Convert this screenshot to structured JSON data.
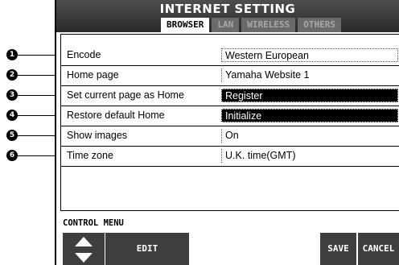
{
  "window": {
    "title": "INTERNET SETTING"
  },
  "tabs": [
    {
      "label": "BROWSER",
      "active": true
    },
    {
      "label": "LAN",
      "active": false
    },
    {
      "label": "WIRELESS",
      "active": false
    },
    {
      "label": "OTHERS",
      "active": false
    }
  ],
  "settings": [
    {
      "number": "1",
      "label": "Encode",
      "value": "Western European"
    },
    {
      "number": "2",
      "label": "Home page",
      "value": "Yamaha Website 1"
    },
    {
      "number": "3",
      "label": "Set current page as Home",
      "value": "Register"
    },
    {
      "number": "4",
      "label": "Restore default Home",
      "value": "Initialize"
    },
    {
      "number": "5",
      "label": "Show images",
      "value": "On"
    },
    {
      "number": "6",
      "label": "Time zone",
      "value": "U.K. time(GMT)"
    }
  ],
  "control_menu": {
    "label": "CONTROL MENU",
    "edit_label": "EDIT",
    "save_label": "SAVE",
    "cancel_label": "CANCEL",
    "up_icon": "triangle-up-icon",
    "down_icon": "triangle-down-icon"
  },
  "colors": {
    "titlebar": "#3a3a3a",
    "button": "#3e3e3e",
    "active_tab": "#ffffff",
    "inactive_tab": "#6a6a6a"
  }
}
